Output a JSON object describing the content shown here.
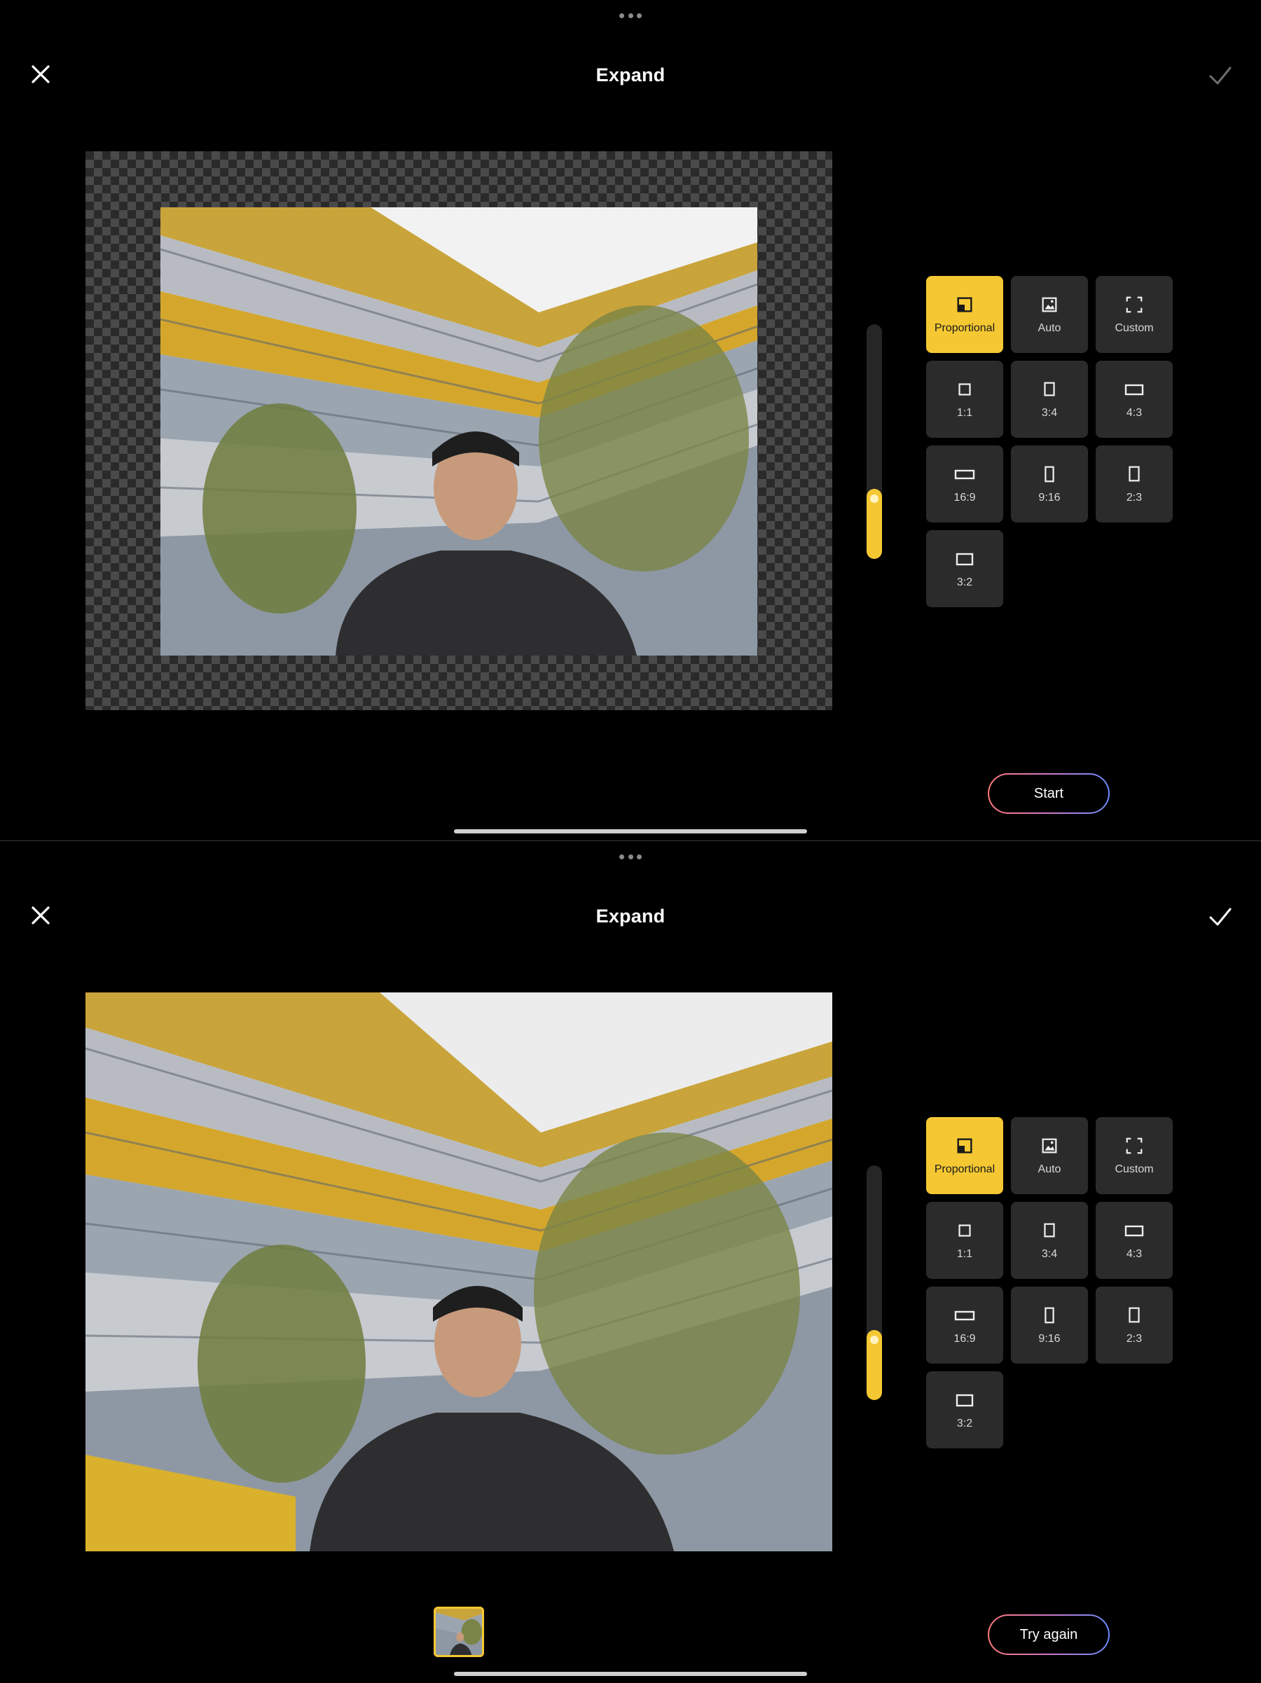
{
  "app": {
    "title": "Expand"
  },
  "screens": [
    {
      "id": "before",
      "title": "Expand",
      "action_label": "Start",
      "slider_level_percent": 30,
      "confirm_enabled": false
    },
    {
      "id": "after",
      "title": "Expand",
      "action_label": "Try again",
      "slider_level_percent": 30,
      "confirm_enabled": true
    }
  ],
  "ratio_options": [
    {
      "label": "Proportional",
      "icon": "proportional-icon",
      "selected": true
    },
    {
      "label": "Auto",
      "icon": "auto-image-icon",
      "selected": false
    },
    {
      "label": "Custom",
      "icon": "custom-frame-icon",
      "selected": false
    },
    {
      "label": "1:1",
      "icon": "ratio-1-1-icon",
      "selected": false
    },
    {
      "label": "3:4",
      "icon": "ratio-3-4-icon",
      "selected": false
    },
    {
      "label": "4:3",
      "icon": "ratio-4-3-icon",
      "selected": false
    },
    {
      "label": "16:9",
      "icon": "ratio-16-9-icon",
      "selected": false
    },
    {
      "label": "9:16",
      "icon": "ratio-9-16-icon",
      "selected": false
    },
    {
      "label": "2:3",
      "icon": "ratio-2-3-icon",
      "selected": false
    },
    {
      "label": "3:2",
      "icon": "ratio-3-2-icon",
      "selected": false
    }
  ],
  "colors": {
    "accent": "#f5c833",
    "tile": "#2b2b2b",
    "background": "#000000",
    "button_gradient": [
      "#ff7a7a",
      "#d079c8",
      "#6b8bff"
    ]
  }
}
